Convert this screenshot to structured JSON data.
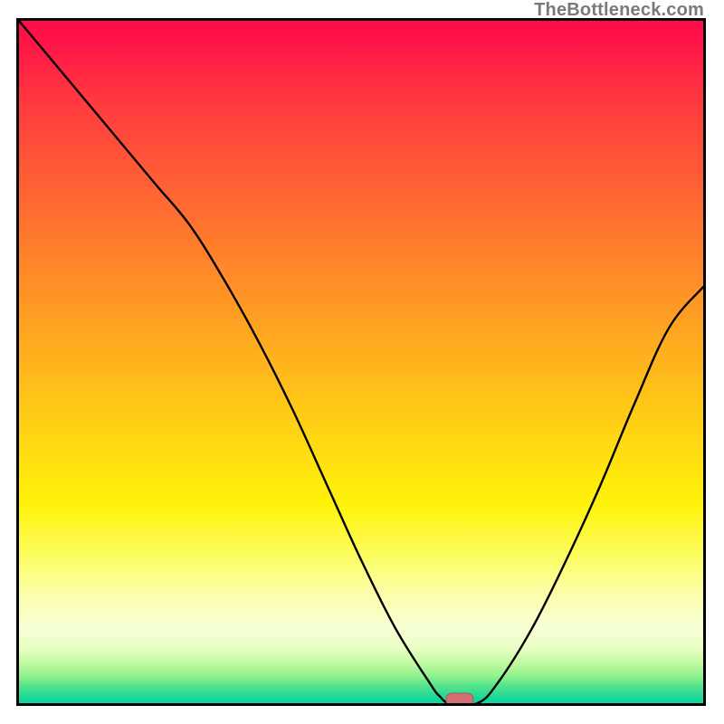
{
  "watermark": "TheBottleneck.com",
  "chart_data": {
    "type": "line",
    "title": "",
    "xlabel": "",
    "ylabel": "",
    "xlim": [
      0,
      100
    ],
    "ylim": [
      0,
      100
    ],
    "grid": false,
    "x": [
      0,
      5,
      10,
      15,
      20,
      25,
      30,
      35,
      40,
      45,
      50,
      55,
      60,
      61.5,
      63,
      67,
      70,
      75,
      80,
      85,
      90,
      95,
      100
    ],
    "values": [
      100,
      94,
      88,
      82,
      76,
      70,
      62,
      53,
      43,
      32,
      21,
      11,
      3,
      1,
      0,
      0,
      3,
      11,
      21,
      32,
      44,
      55,
      61
    ],
    "marker": {
      "x": 64.4,
      "y": 0.5
    },
    "gradient_bands": [
      {
        "color": "#ff0a4a",
        "stop": 0
      },
      {
        "color": "#ff3a3f",
        "stop": 12
      },
      {
        "color": "#ff7a2d",
        "stop": 32
      },
      {
        "color": "#ffba1b",
        "stop": 52
      },
      {
        "color": "#fff30a",
        "stop": 71
      },
      {
        "color": "#fbfeaa",
        "stop": 84
      },
      {
        "color": "#c4fba2",
        "stop": 94
      },
      {
        "color": "#2fdb92",
        "stop": 98
      },
      {
        "color": "#0cd4a0",
        "stop": 100
      }
    ]
  }
}
